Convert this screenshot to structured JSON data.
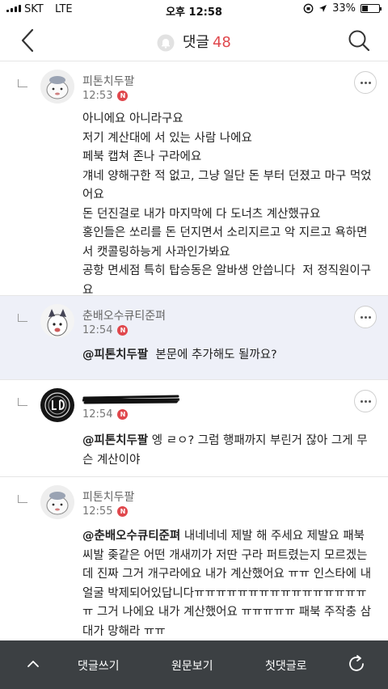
{
  "status_bar": {
    "carrier": "SKT",
    "network": "LTE",
    "time": "오후 12:58",
    "battery": "33%",
    "battery_level": 0.33
  },
  "header": {
    "title": "댓글",
    "count": "48"
  },
  "comments": [
    {
      "author": "피톤치두팔",
      "time": "12:53",
      "new_badge": "N",
      "mention": "",
      "text": "아니에요 아니라구요\n저기 계산대에 서 있는 사람 나에요\n페북 캡쳐 존나 구라에요\n걔네 양해구한 적 없고, 그냥 일단 돈 부터 던졌고 마구 먹었어요\n돈 던진걸로 내가 마지막에 다 도너츠 계산했규요\n홍인들은 쏘리를 돈 던지면서 소리지르고 악 지르고 욕하면서 캣콜링하능게 사과인가봐요\n공항 면세점 특히 탑승동은 알바생 안씁니다  저 정직원이구요"
    },
    {
      "author": "춘배오수큐티준펴",
      "time": "12:54",
      "new_badge": "N",
      "mention": "@피톤치두팔",
      "text": "  본문에 추가해도 될까요?"
    },
    {
      "author": "",
      "time": "12:54",
      "new_badge": "N",
      "mention": "@피톤치두팔",
      "text": " 엥 ㄹㅇ? 그럼 행패까지 부린거 잖아 그게 무슨 계산이야"
    },
    {
      "author": "피톤치두팔",
      "time": "12:55",
      "new_badge": "N",
      "mention": "@춘배오수큐티준펴",
      "text": "  내네네네 제발 해 주세요 제발요 패북 씨발 좆같은 어떤 개새끼가 저딴 구라 퍼트렸는지 모르겠는데 진짜 그거 개구라에요 내가 계산했어요 ㅠㅠ 인스타에 내 얼굴 박제되어있답니다ㅠㅠㅠㅠㅠㅠㅠㅠㅠㅠㅠㅠㅠㅠㅠㅠㅠ 그거 나에요 내가 계산했어요 ㅠㅠㅠㅠㅠ 패북 주작충 삼대가 망해라 ㅠㅠ"
    }
  ],
  "bottom_bar": {
    "write": "댓글쓰기",
    "original": "원문보기",
    "first": "첫댓글로"
  },
  "icons": {
    "back": "chevron-left-icon",
    "search": "search-icon",
    "bell": "bell-icon",
    "more": "more-icon",
    "up": "chevron-up-icon",
    "refresh": "refresh-icon"
  },
  "colors": {
    "accent": "#e0474c",
    "bottom_bar": "#3c4043",
    "highlight": "#eef0f8"
  }
}
